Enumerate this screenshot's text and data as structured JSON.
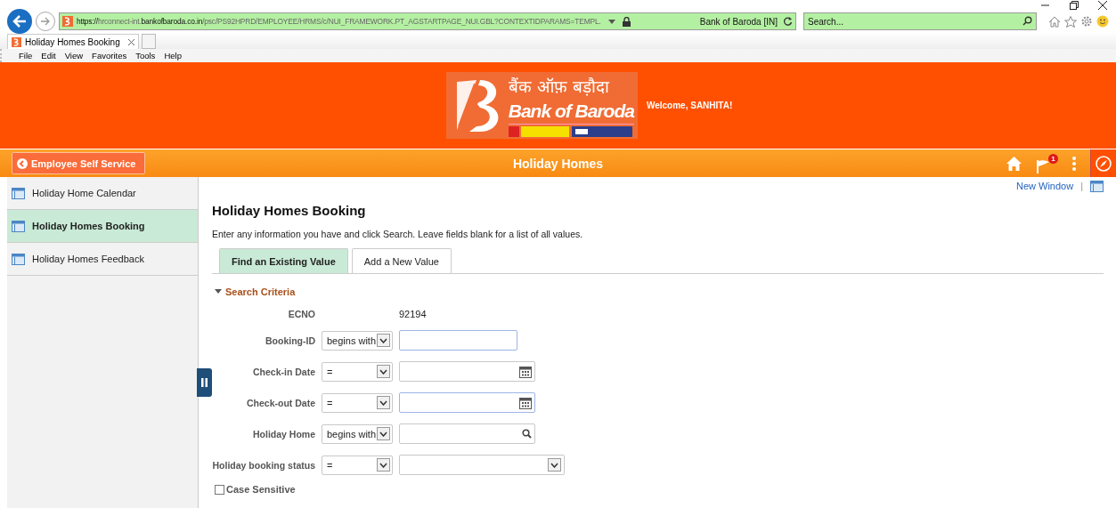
{
  "browser": {
    "url": "**https://**hrconnect-int.**bankofbaroda.co.in**/psc/PS92HPRD/EMPLOYEE/HRMS/c/NUI_FRAMEWORK.PT_AGSTARTPAGE_NUI.GBL?CONTEXTIDPARAMS=TEMPL.",
    "site_identity": "Bank of Baroda [IN]",
    "search_placeholder": "Search...",
    "tabs": [
      {
        "label": "Holiday Homes Booking",
        "selected": true
      }
    ],
    "menu": [
      "File",
      "Edit",
      "View",
      "Favorites",
      "Tools",
      "Help"
    ]
  },
  "header": {
    "logo_hindi": "बैंक ऑफ़ बड़ौदा",
    "logo_english": "Bank of Baroda",
    "welcome": "Welcome, SANHITA!"
  },
  "navbar": {
    "back_label": "Employee Self Service",
    "title": "Holiday Homes",
    "notification_count": "1"
  },
  "sidebar": {
    "items": [
      {
        "label": "Holiday Home Calendar",
        "selected": false
      },
      {
        "label": "Holiday Homes Booking",
        "selected": true
      },
      {
        "label": "Holiday Homes Feedback",
        "selected": false
      }
    ]
  },
  "page": {
    "new_window": "New Window",
    "separator": "|",
    "title": "Holiday Homes Booking",
    "instructions": "Enter any information you have and click Search. Leave fields blank for a list of all values.",
    "tabs": [
      {
        "label": "Find an Existing Value",
        "selected": true
      },
      {
        "label": "Add a New Value",
        "selected": false
      }
    ],
    "section": {
      "title": "Search Criteria",
      "expanded": true
    },
    "fields": [
      {
        "kind": "static",
        "label": "ECNO",
        "value": "92194"
      },
      {
        "kind": "text",
        "label": "Booking-ID",
        "operator": "begins with",
        "focused": true
      },
      {
        "kind": "date",
        "label": "Check-in Date",
        "operator": "=",
        "focused": false
      },
      {
        "kind": "date",
        "label": "Check-out Date",
        "operator": "=",
        "focused": true
      },
      {
        "kind": "lookup",
        "label": "Holiday Home",
        "operator": "begins with",
        "focused": false
      },
      {
        "kind": "dropdown",
        "label": "Holiday booking status",
        "operator": "=",
        "focused": false
      }
    ],
    "case_sensitive": {
      "label": "Case Sensitive",
      "checked": false
    }
  }
}
